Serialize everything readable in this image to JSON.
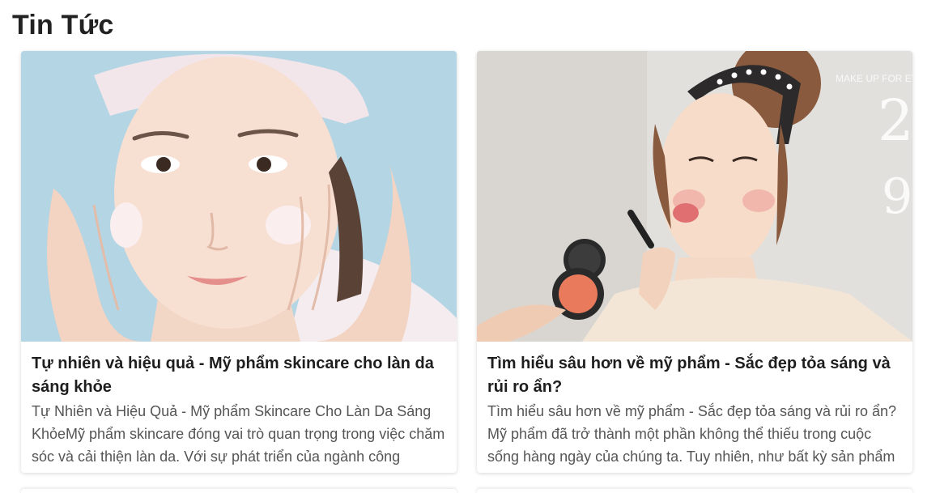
{
  "section": {
    "title": "Tin Tức"
  },
  "news": [
    {
      "title": "Tự nhiên và hiệu quả - Mỹ phẩm skincare cho làn da sáng khỏe",
      "excerpt": "Tự Nhiên và Hiệu Quả - Mỹ phẩm Skincare Cho Làn Da Sáng KhỏeMỹ phẩm skincare đóng vai trò quan trọng trong việc chăm sóc và cải thiện làn da. Với sự phát triển của ngành công nghiệp"
    },
    {
      "title": "Tìm hiểu sâu hơn về mỹ phẩm - Sắc đẹp tỏa sáng và rủi ro ẩn?",
      "excerpt": "Tìm hiểu sâu hơn về mỹ phẩm - Sắc đẹp tỏa sáng và rủi ro ẩn? Mỹ phẩm đã trở thành một phần không thể thiếu trong cuộc sống hàng ngày của chúng ta. Tuy nhiên, như bất kỳ sản phẩm nào"
    }
  ],
  "watermark": "MAKE UP FOR EV",
  "colors": {
    "card1_bg": "#b3d5e4",
    "card2_bg": "#e2e0dc"
  }
}
